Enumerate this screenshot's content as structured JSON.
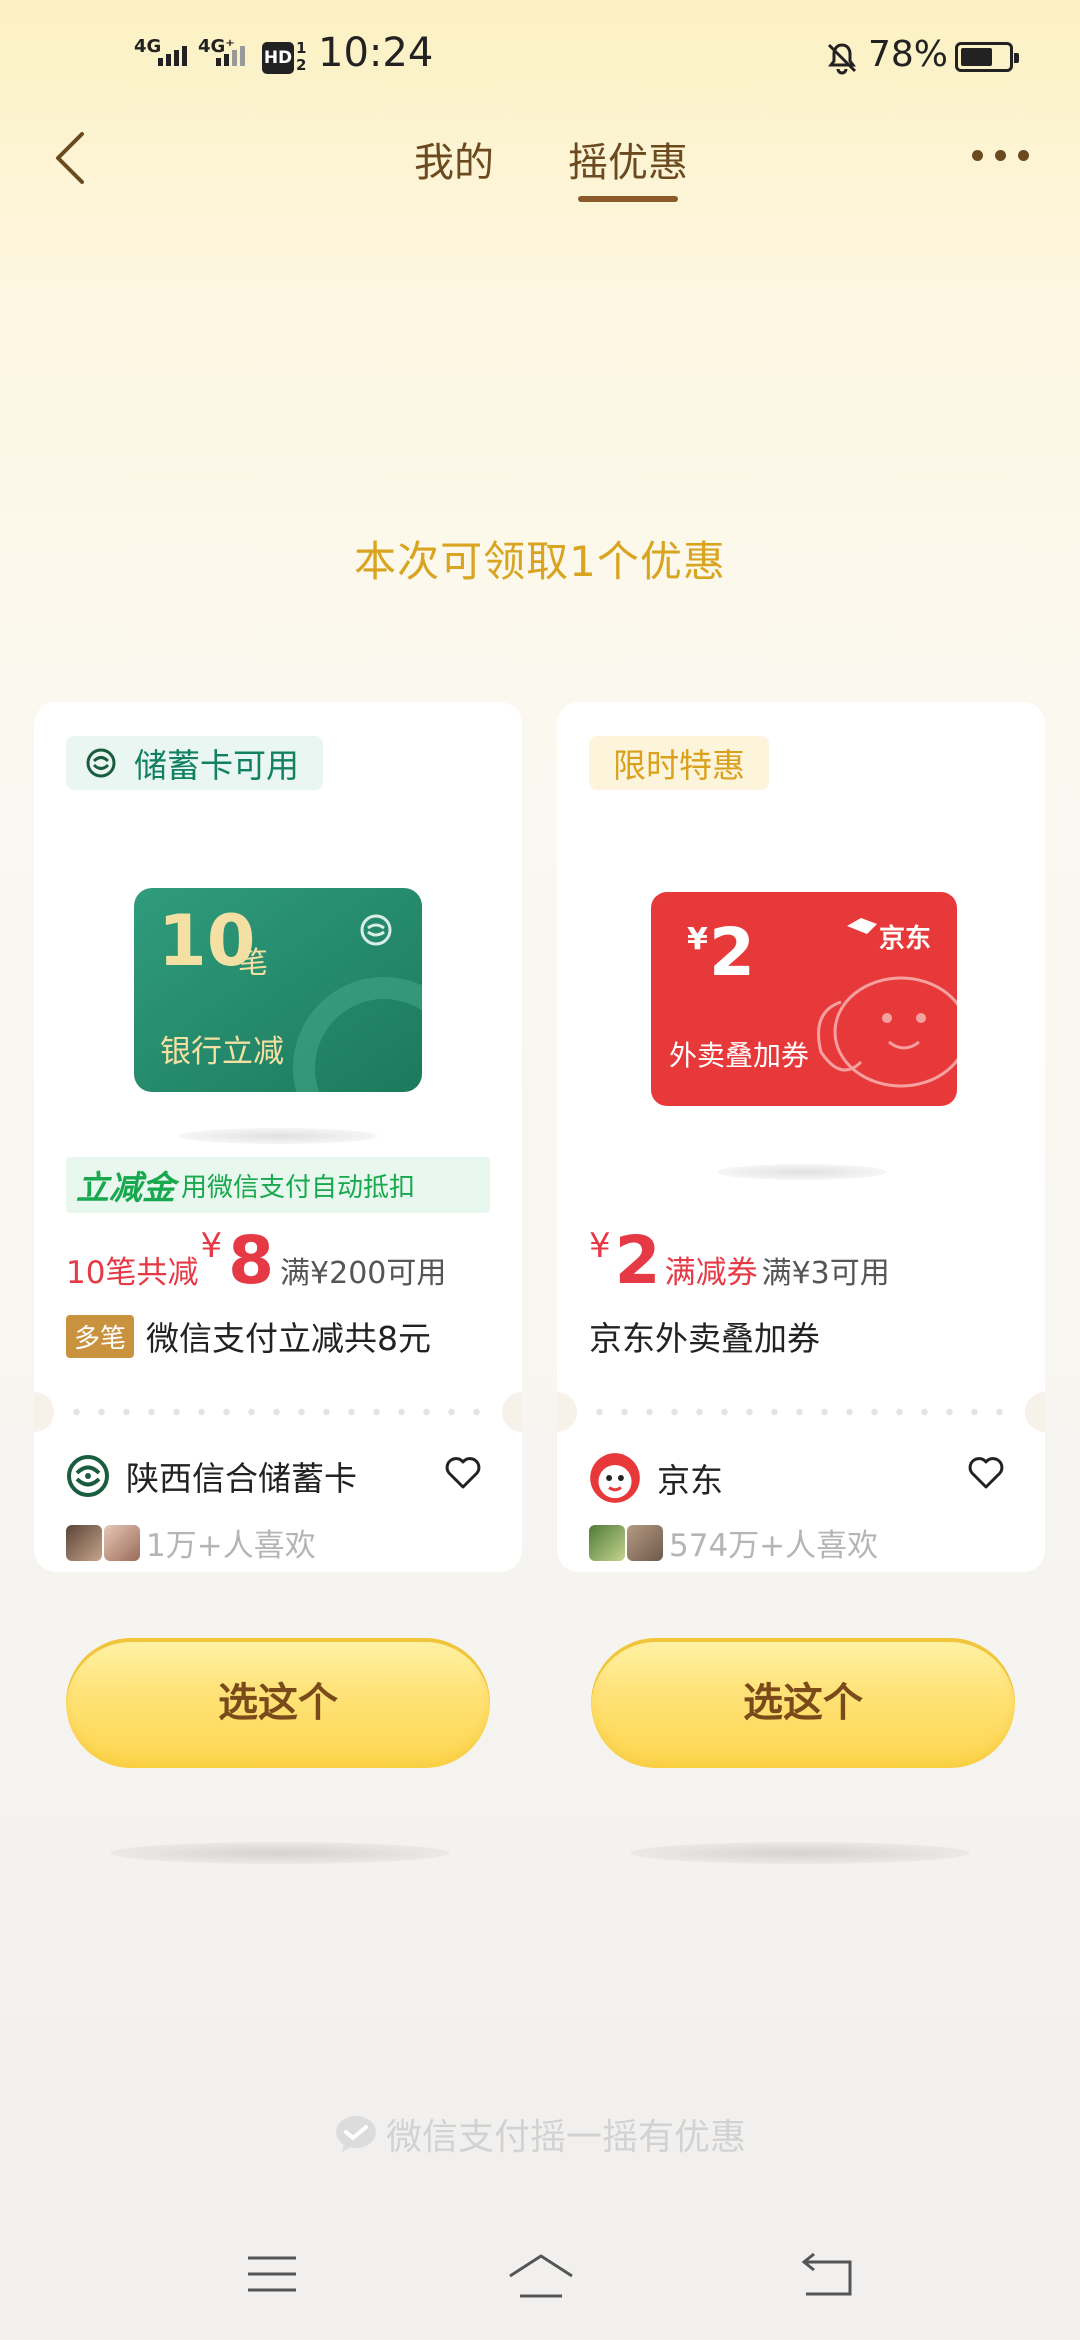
{
  "status_bar": {
    "sim1": "4G",
    "sim2": "4G⁺",
    "hd": "HD",
    "hd_sub": "1\n2",
    "time": "10:24",
    "battery": "78%",
    "battery_level": 0.78
  },
  "nav": {
    "tabs": [
      "我的",
      "摇优惠"
    ],
    "active_tab": "摇优惠"
  },
  "headline": "本次可领取1个优惠",
  "cards": [
    {
      "badge": "储蓄卡可用",
      "coupon_big": "10",
      "coupon_unit": "笔",
      "coupon_sub": "银行立减",
      "tag_strong": "立减金",
      "tag_rest": "用微信支付自动抵扣",
      "price_prefix": "10笔共减",
      "currency": "¥",
      "amount": "8",
      "condition": "满¥200可用",
      "multi_label": "多笔",
      "title": "微信支付立减共8元",
      "merchant": "陕西信合储蓄卡",
      "likes": "1万+人喜欢",
      "button": "选这个"
    },
    {
      "badge": "限时特惠",
      "coupon_currency": "¥",
      "coupon_big": "2",
      "coupon_brand": "京东",
      "coupon_sub": "外卖叠加券",
      "currency": "¥",
      "amount": "2",
      "amount_label": "满减券",
      "condition": "满¥3可用",
      "title": "京东外卖叠加券",
      "merchant": "京东",
      "likes": "574万+人喜欢",
      "button": "选这个"
    }
  ],
  "footer": "微信支付摇一摇有优惠",
  "colors": {
    "accent_gold": "#d9a521",
    "price_red": "#e53945",
    "green": "#128162",
    "button_yellow": "#fdd64e"
  }
}
